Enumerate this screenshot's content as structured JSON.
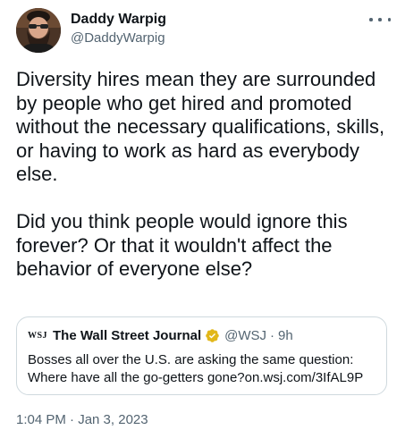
{
  "author": {
    "display_name": "Daddy Warpig",
    "handle": "@DaddyWarpig",
    "avatar_icon": "bearded-man-avatar"
  },
  "more_icon": "more-horizontal-icon",
  "tweet": {
    "paragraphs": [
      "Diversity hires mean they are surrounded by people who get hired and promoted without the necessary qualifications, skills, or having to work as hard as everybody else.",
      "Did you think people would ignore this forever? Or that it wouldn't affect the behavior of everyone else?"
    ],
    "timestamp": "1:04 PM · Jan 3, 2023"
  },
  "quoted_tweet": {
    "logo_text": "WSJ",
    "name": "The Wall Street Journal",
    "verified_color": "#e2b719",
    "handle": "@WSJ",
    "separator": "·",
    "time": "9h",
    "text": "Bosses all over the U.S. are asking the same question: Where have all the go-getters gone?on.wsj.com/3IfAL9P"
  },
  "colors": {
    "text_primary": "#0f1419",
    "text_secondary": "#536471",
    "border": "#cfd9de"
  }
}
